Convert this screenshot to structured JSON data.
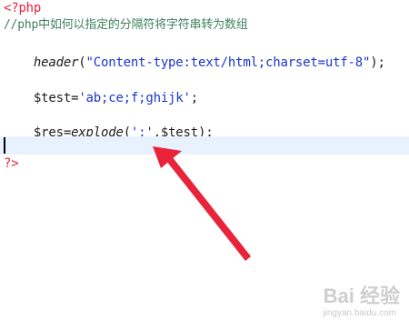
{
  "code": {
    "php_open": "<?php",
    "comment": "//php中如何以指定的分隔符将字符串转为数组",
    "line_header": {
      "func": "header",
      "open": "(",
      "arg": "\"Content-type:text/html;charset=utf-8\"",
      "close": ");"
    },
    "line_test": {
      "var": "$test",
      "eq": "=",
      "value": "'ab;ce;f;ghijk'",
      "end": ";"
    },
    "line_res": {
      "var": "$res",
      "eq": "=",
      "func": "explode",
      "open": "(",
      "sep": "';'",
      "rest": ",$test);"
    },
    "php_close": "?>"
  },
  "colors": {
    "keyword_red": "#e8233a",
    "comment_green": "#3f7f5f",
    "string_blue": "#1a36c9",
    "active_line": "#e8f2fe",
    "arrow": "#e8233a"
  },
  "watermark": {
    "brand": "Bai 经验",
    "url": "jingyan.baidu.com"
  }
}
